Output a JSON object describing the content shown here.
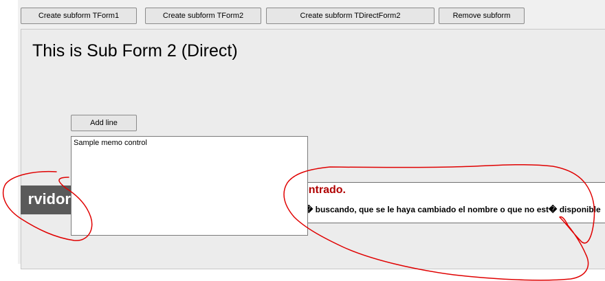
{
  "toolbar": {
    "create_tform1": "Create subform TForm1",
    "create_tform2": "Create subform TForm2",
    "create_tdirectform2": "Create subform TDirectForm2",
    "remove_subform": "Remove subform"
  },
  "subform": {
    "title": "This is Sub Form 2 (Direct)",
    "add_line_label": "Add line",
    "memo_value": "Sample memo control"
  },
  "error_page": {
    "left_fragment": "rvidor",
    "title_fragment": "ontrado.",
    "description_fragment": "� buscando, que se le haya cambiado el nombre o que no est� disponible"
  },
  "annotation_color": "#e00000"
}
